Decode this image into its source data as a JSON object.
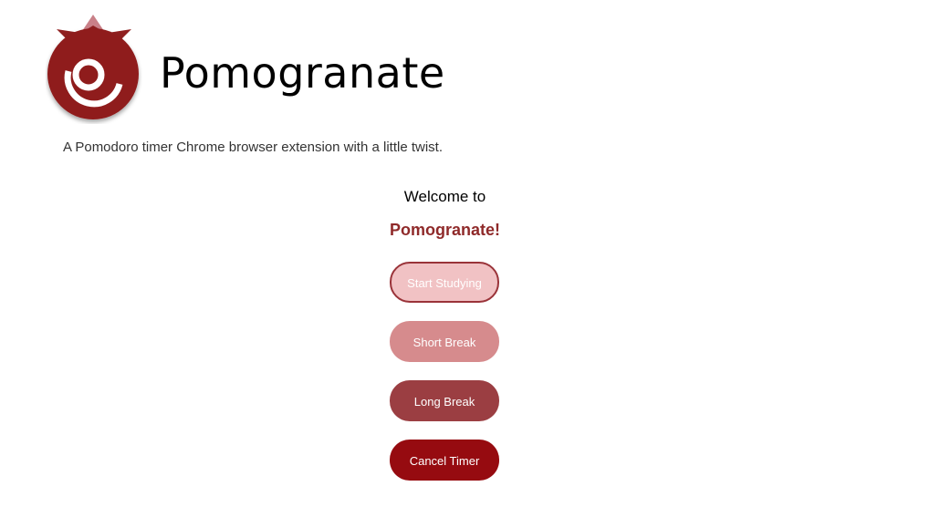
{
  "header": {
    "app_name": "Pomogranate",
    "tagline": "A Pomodoro timer Chrome browser extension with a little twist."
  },
  "popup": {
    "welcome_text": "Welcome to",
    "brand_text": "Pomogranate!",
    "buttons": {
      "start": "Start Studying",
      "short_break": "Short Break",
      "long_break": "Long Break",
      "cancel": "Cancel Timer"
    }
  },
  "colors": {
    "logo_fruit": "#8f1f1f",
    "logo_crown": "#c98088",
    "brand_text": "#8f2a2a",
    "start_bg": "#f1c2c4",
    "start_border": "#9a3339",
    "short_break_bg": "#d68b8d",
    "long_break_bg": "#9b3e42",
    "cancel_bg": "#960b10"
  },
  "icons": {
    "logo": "pomegranate-logo-icon"
  }
}
